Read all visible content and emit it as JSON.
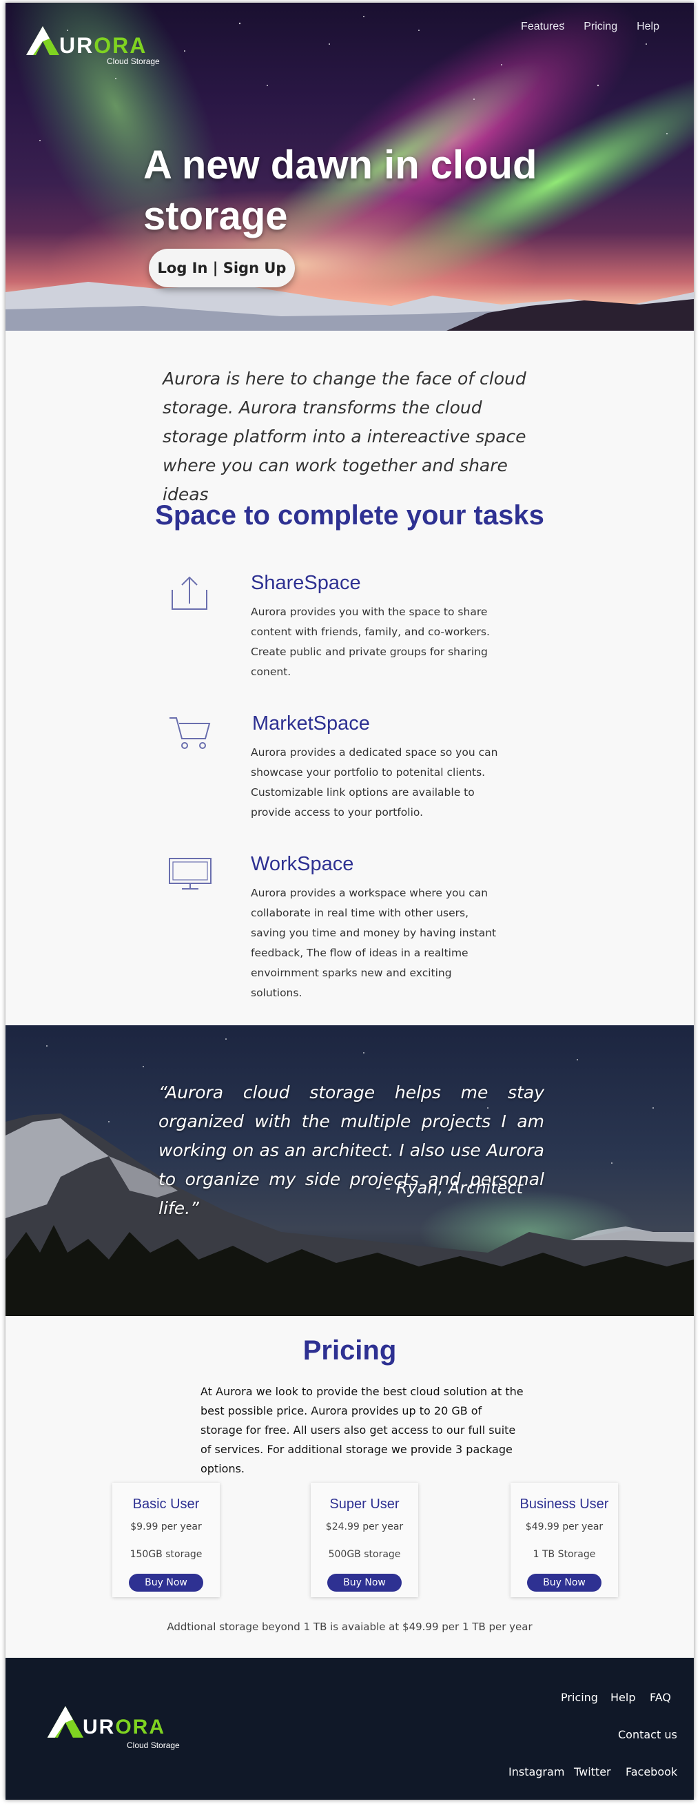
{
  "brand": {
    "word_a": "A",
    "word_ur": "UR",
    "word_ora": "ORA",
    "tagline": "Cloud Storage"
  },
  "nav": [
    {
      "label": "Features"
    },
    {
      "label": "Pricing"
    },
    {
      "label": "Help"
    }
  ],
  "hero": {
    "title": "A new dawn in cloud storage",
    "cta_label": "Log In | Sign Up"
  },
  "intro": {
    "text": "Aurora is here to change the face of cloud storage. Aurora transforms the cloud storage platform into a intereactive space where you can work together and share ideas"
  },
  "tasks": {
    "title": "Space to complete your tasks",
    "features": [
      {
        "icon": "upload-icon",
        "title": "ShareSpace",
        "text": "Aurora provides you with the space to share content with friends, family, and co-workers. Create public and private groups for sharing conent."
      },
      {
        "icon": "cart-icon",
        "title": "MarketSpace",
        "text": "Aurora provides a dedicated space so you can showcase your portfolio to potenital clients. Customizable link options are available to provide access to your portfolio."
      },
      {
        "icon": "monitor-icon",
        "title": "WorkSpace",
        "text": "Aurora provides a workspace where you  can collaborate in real time with other users, saving you time and money by having instant feedback, The flow of ideas in a realtime envoirnment sparks new and exciting solutions."
      }
    ]
  },
  "testimonial": {
    "quote": "“Aurora cloud storage helps me stay organized with the multiple projects I am working on as an architect. I also use Aurora to organize my side projects and personal life.”",
    "author": "- Ryan, Architect"
  },
  "pricing": {
    "title": "Pricing",
    "description": "At Aurora we look to provide the best cloud solution at the best possible price. Aurora provides up to 20 GB of storage for free. All users also get access to our full suite of services. For additional storage we provide 3 package options.",
    "plans": [
      {
        "name": "Basic User",
        "price": "$9.99 per year",
        "storage": "150GB storage",
        "button": "Buy Now"
      },
      {
        "name": "Super User",
        "price": "$24.99 per year",
        "storage": "500GB storage",
        "button": "Buy Now"
      },
      {
        "name": "Business User",
        "price": "$49.99 per year",
        "storage": "1 TB Storage",
        "button": "Buy Now"
      }
    ],
    "additional": "Addtional storage beyond 1 TB is avaiable at $49.99 per 1 TB per year"
  },
  "footer": {
    "links_top": [
      {
        "label": "Pricing"
      },
      {
        "label": "Help"
      },
      {
        "label": "FAQ"
      }
    ],
    "contact": "Contact us",
    "social": [
      {
        "label": "Instagram"
      },
      {
        "label": "Twitter"
      },
      {
        "label": "Facebook"
      }
    ]
  },
  "colors": {
    "primary": "#2e3192",
    "accent_green": "#7fd321",
    "footer_bg": "#101828"
  }
}
